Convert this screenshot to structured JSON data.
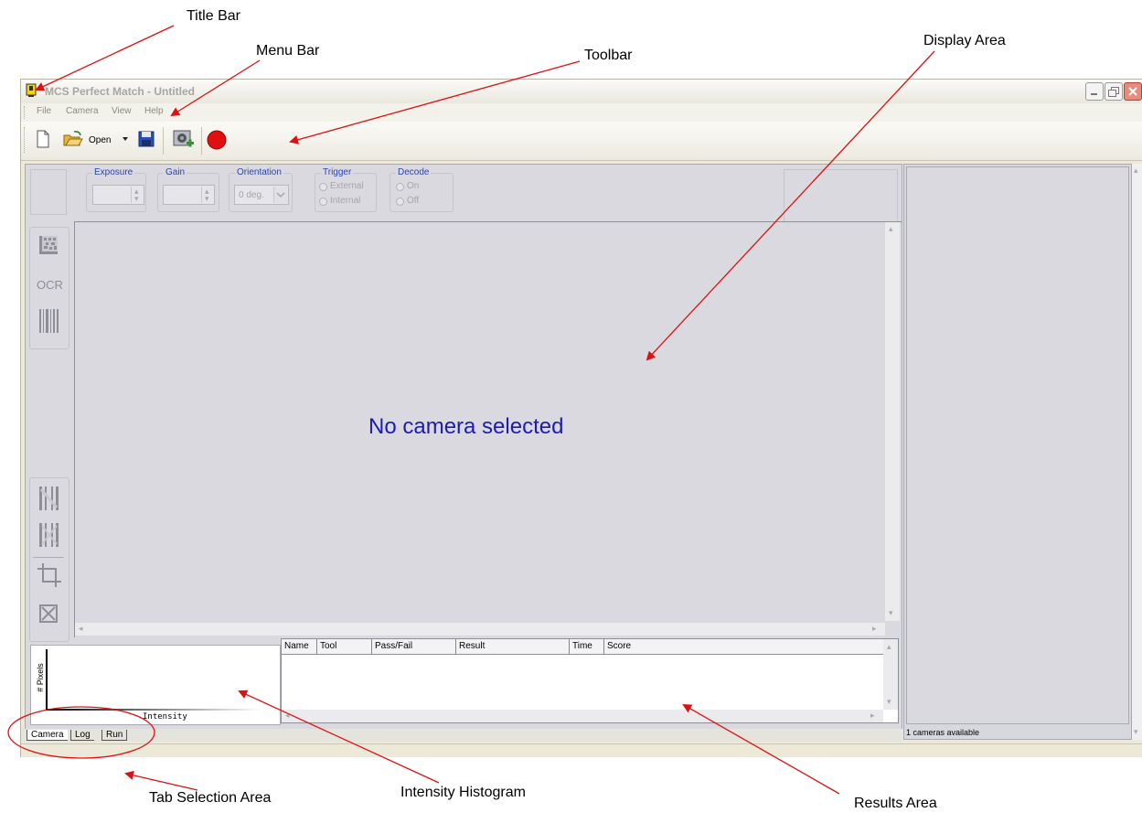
{
  "annotations": {
    "title_bar": "Title Bar",
    "menu_bar": "Menu Bar",
    "toolbar": "Toolbar",
    "display_area": "Display Area",
    "tab_selection_area": "Tab Selection Area",
    "intensity_histogram": "Intensity Histogram",
    "results_area": "Results Area"
  },
  "window": {
    "title": "MCS Perfect Match - Untitled",
    "app_icon": "app-icon",
    "controls": [
      "minimize-icon",
      "restore-icon",
      "close-icon"
    ]
  },
  "menu": {
    "items": [
      "File",
      "Camera",
      "View",
      "Help"
    ]
  },
  "toolbar": {
    "open_label": "Open",
    "icons": [
      "new-document-icon",
      "open-folder-icon",
      "dropdown-arrow-icon",
      "save-icon",
      "add-camera-icon",
      "record-icon"
    ]
  },
  "camera_controls": {
    "exposure_label": "Exposure",
    "gain_label": "Gain",
    "orientation_label": "Orientation",
    "orientation_value": "0 deg.",
    "trigger_label": "Trigger",
    "trigger_external": "External",
    "trigger_internal": "Internal",
    "decode_label": "Decode",
    "decode_on": "On",
    "decode_off": "Off"
  },
  "tools": {
    "ocr_label": "OCR",
    "icons": [
      "datamatrix-tool-icon",
      "ocr-tool-icon",
      "barcode-tool-icon",
      "tool-a-icon",
      "tool-b-icon",
      "crop-icon",
      "delete-box-icon"
    ]
  },
  "display": {
    "message": "No camera selected",
    "message_color": "#1c1cb4"
  },
  "histogram": {
    "y_label": "# Pixels",
    "x_label": "Intensity"
  },
  "results": {
    "columns": [
      "Name",
      "Tool",
      "Pass/Fail",
      "Result",
      "Time",
      "Score"
    ]
  },
  "tabs": [
    "Camera",
    "Log",
    "Run"
  ],
  "status": {
    "cameras": "1 cameras available"
  },
  "colors": {
    "annotation_arrow": "#e01010",
    "record": "#e01010"
  }
}
